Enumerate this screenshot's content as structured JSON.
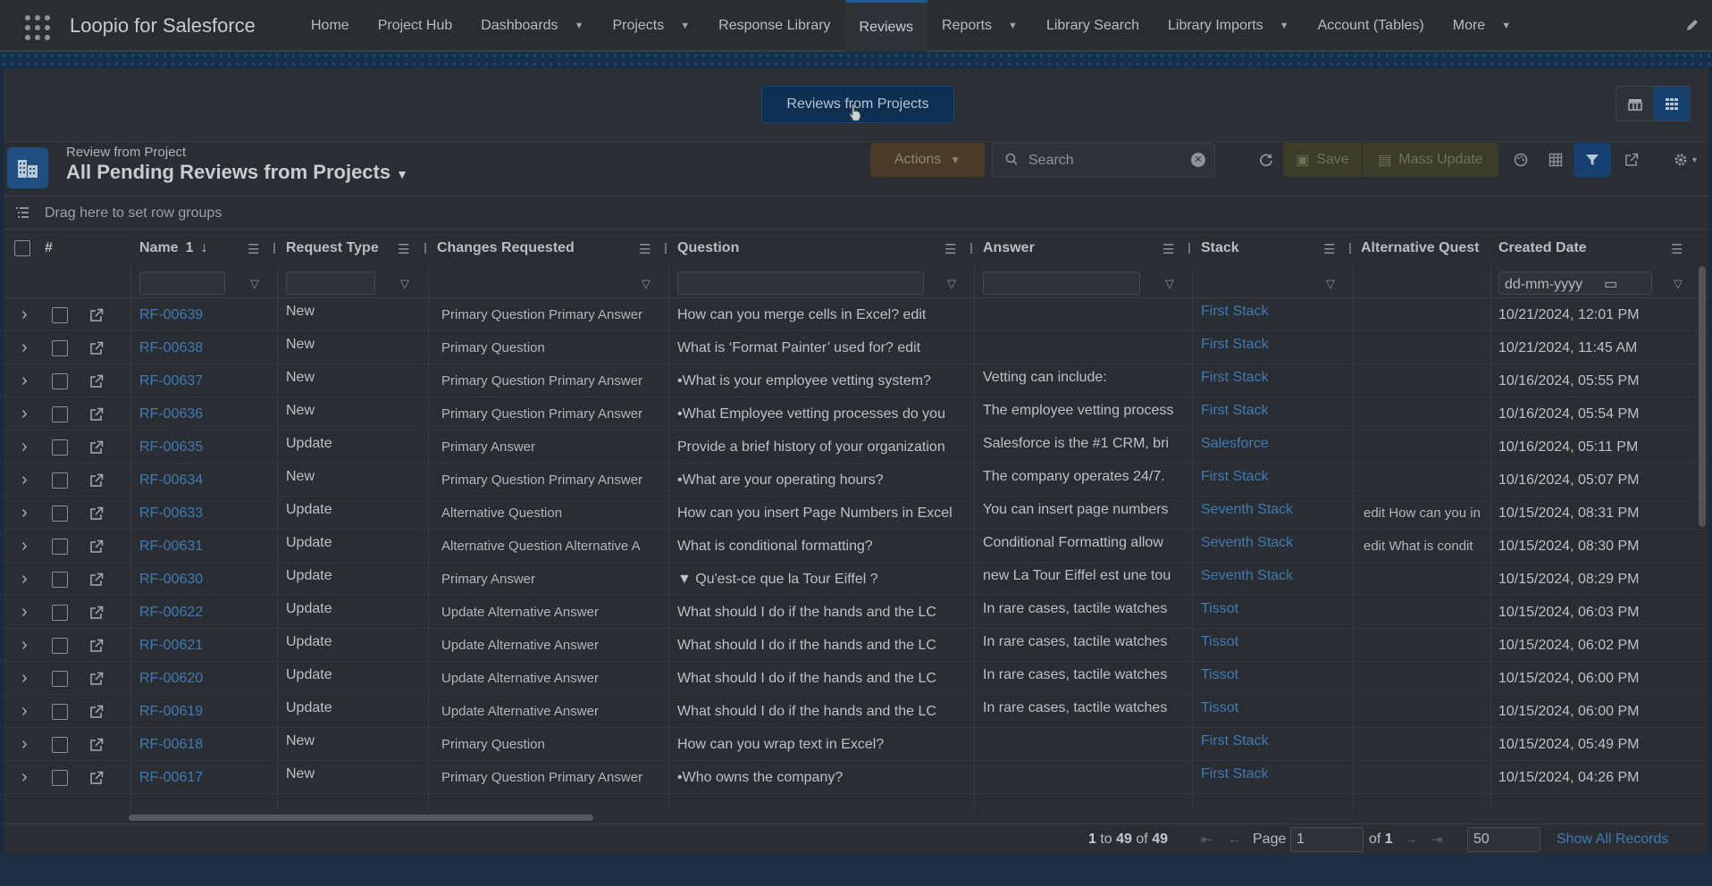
{
  "topnav": {
    "app_name": "Loopio for Salesforce",
    "items": [
      {
        "label": "Home",
        "dropdown": false
      },
      {
        "label": "Project Hub",
        "dropdown": false
      },
      {
        "label": "Dashboards",
        "dropdown": true
      },
      {
        "label": "Projects",
        "dropdown": true
      },
      {
        "label": "Response Library",
        "dropdown": false
      },
      {
        "label": "Reviews",
        "dropdown": false,
        "active": true
      },
      {
        "label": "Reports",
        "dropdown": true
      },
      {
        "label": "Library Search",
        "dropdown": false
      },
      {
        "label": "Library Imports",
        "dropdown": true
      },
      {
        "label": "Account (Tables)",
        "dropdown": false
      },
      {
        "label": "More",
        "dropdown": true
      }
    ]
  },
  "card": {
    "primary_button": "Reviews from Projects"
  },
  "list": {
    "object_label": "Review from Project",
    "title": "All Pending Reviews from Projects",
    "actions_label": "Actions",
    "search_placeholder": "Search",
    "save_label": "Save",
    "mass_update_label": "Mass Update",
    "row_groups_text": "Drag here to set row groups"
  },
  "columns": {
    "index": "#",
    "name": "Name",
    "name_sort": "1",
    "request_type": "Request Type",
    "changes_requested": "Changes Requested",
    "question": "Question",
    "answer": "Answer",
    "stack": "Stack",
    "alt_question": "Alternative Quest",
    "created_date": "Created Date",
    "date_placeholder": "dd-mm-yyyy"
  },
  "rows": [
    {
      "name": "RF-00639",
      "type": "New",
      "changes": "Primary Question  Primary Answer",
      "question": "How can you merge cells in Excel? edit",
      "answer": "",
      "stack": "First Stack",
      "alt": "",
      "date": "10/21/2024, 12:01 PM"
    },
    {
      "name": "RF-00638",
      "type": "New",
      "changes": "Primary Question",
      "question": "What is ‘Format Painter’ used for? edit",
      "answer": "",
      "stack": "First Stack",
      "alt": "",
      "date": "10/21/2024, 11:45 AM"
    },
    {
      "name": "RF-00637",
      "type": "New",
      "changes": "Primary Question  Primary Answer",
      "question": "•What is your employee vetting system?",
      "answer": "Vetting can include:",
      "stack": "First Stack",
      "alt": "",
      "date": "10/16/2024, 05:55 PM"
    },
    {
      "name": "RF-00636",
      "type": "New",
      "changes": "Primary Question  Primary Answer",
      "question": "•What Employee vetting processes do you",
      "answer": "The employee vetting process",
      "stack": "First Stack",
      "alt": "",
      "date": "10/16/2024, 05:54 PM"
    },
    {
      "name": "RF-00635",
      "type": "Update",
      "changes": "Primary Answer",
      "question": "Provide a brief history of your organization",
      "answer": "Salesforce is the #1 CRM, bri",
      "stack": "Salesforce",
      "alt": "",
      "date": "10/16/2024, 05:11 PM"
    },
    {
      "name": "RF-00634",
      "type": "New",
      "changes": "Primary Question  Primary Answer",
      "question": "•What are your operating hours?",
      "answer": "The company operates 24/7.",
      "stack": "First Stack",
      "alt": "",
      "date": "10/16/2024, 05:07 PM"
    },
    {
      "name": "RF-00633",
      "type": "Update",
      "changes": "Alternative Question",
      "question": "How can you insert Page Numbers in Excel",
      "answer": "You can insert page numbers",
      "stack": "Seventh Stack",
      "alt": "edit How can you in",
      "date": "10/15/2024, 08:31 PM"
    },
    {
      "name": "RF-00631",
      "type": "Update",
      "changes": "Alternative Question  Alternative A",
      "question": "What is conditional formatting?",
      "answer": "Conditional Formatting allow",
      "stack": "Seventh Stack",
      "alt": "edit What is condit",
      "date": "10/15/2024, 08:30 PM"
    },
    {
      "name": "RF-00630",
      "type": "Update",
      "changes": "Primary Answer",
      "question": "▼ Qu'est-ce que la Tour Eiffel ?",
      "answer": "new La Tour Eiffel est une tou",
      "stack": "Seventh Stack",
      "alt": "",
      "date": "10/15/2024, 08:29 PM"
    },
    {
      "name": "RF-00622",
      "type": "Update",
      "changes": "Update Alternative Answer",
      "question": "What should I do if the hands and the LC",
      "answer": "In rare cases, tactile watches",
      "stack": "Tissot",
      "alt": "",
      "date": "10/15/2024, 06:03 PM"
    },
    {
      "name": "RF-00621",
      "type": "Update",
      "changes": "Update Alternative Answer",
      "question": "What should I do if the hands and the LC",
      "answer": "In rare cases, tactile watches",
      "stack": "Tissot",
      "alt": "",
      "date": "10/15/2024, 06:02 PM"
    },
    {
      "name": "RF-00620",
      "type": "Update",
      "changes": "Update Alternative Answer",
      "question": "What should I do if the hands and the LC",
      "answer": "In rare cases, tactile watches",
      "stack": "Tissot",
      "alt": "",
      "date": "10/15/2024, 06:00 PM"
    },
    {
      "name": "RF-00619",
      "type": "Update",
      "changes": "Update Alternative Answer",
      "question": "What should I do if the hands and the LC",
      "answer": "In rare cases, tactile watches",
      "stack": "Tissot",
      "alt": "",
      "date": "10/15/2024, 06:00 PM"
    },
    {
      "name": "RF-00618",
      "type": "New",
      "changes": "Primary Question",
      "question": "How can you wrap text in Excel?",
      "answer": "",
      "stack": "First Stack",
      "alt": "",
      "date": "10/15/2024, 05:49 PM"
    },
    {
      "name": "RF-00617",
      "type": "New",
      "changes": "Primary Question  Primary Answer",
      "question": "•Who owns the company?",
      "answer": "",
      "stack": "First Stack",
      "alt": "",
      "date": "10/15/2024, 04:26 PM"
    }
  ],
  "pager": {
    "from": "1",
    "to_word": "to",
    "to": "49",
    "of_word": "of",
    "total": "49",
    "page_label": "Page",
    "page_value": "1",
    "of_pages_label": "of",
    "pages": "1",
    "page_size": "50",
    "show_all": "Show All Records"
  },
  "colors": {
    "link": "#3f7bb6",
    "active_nav": "#1f5a8f",
    "filter_active": "#164070"
  }
}
